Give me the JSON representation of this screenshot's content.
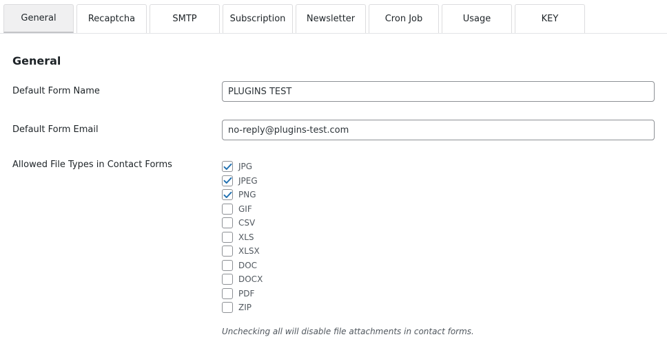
{
  "tabs": [
    {
      "label": "General",
      "active": true
    },
    {
      "label": "Recaptcha",
      "active": false
    },
    {
      "label": "SMTP",
      "active": false
    },
    {
      "label": "Subscription",
      "active": false
    },
    {
      "label": "Newsletter",
      "active": false
    },
    {
      "label": "Cron Job",
      "active": false
    },
    {
      "label": "Usage",
      "active": false
    },
    {
      "label": "KEY",
      "active": false
    }
  ],
  "section": {
    "title": "General"
  },
  "form_name": {
    "label": "Default Form Name",
    "value": "PLUGINS TEST"
  },
  "form_email": {
    "label": "Default Form Email",
    "value": "no-reply@plugins-test.com"
  },
  "file_types": {
    "label": "Allowed File Types in Contact Forms",
    "items": [
      {
        "label": "JPG",
        "checked": true
      },
      {
        "label": "JPEG",
        "checked": true
      },
      {
        "label": "PNG",
        "checked": true
      },
      {
        "label": "GIF",
        "checked": false
      },
      {
        "label": "CSV",
        "checked": false
      },
      {
        "label": "XLS",
        "checked": false
      },
      {
        "label": "XLSX",
        "checked": false
      },
      {
        "label": "DOC",
        "checked": false
      },
      {
        "label": "DOCX",
        "checked": false
      },
      {
        "label": "PDF",
        "checked": false
      },
      {
        "label": "ZIP",
        "checked": false
      }
    ],
    "hint": "Unchecking all will disable file attachments in contact forms."
  },
  "colors": {
    "check_accent": "#2271b1",
    "active_tab_bg": "#f0f0f1"
  },
  "icons": {
    "checkbox_check": "check-icon"
  }
}
